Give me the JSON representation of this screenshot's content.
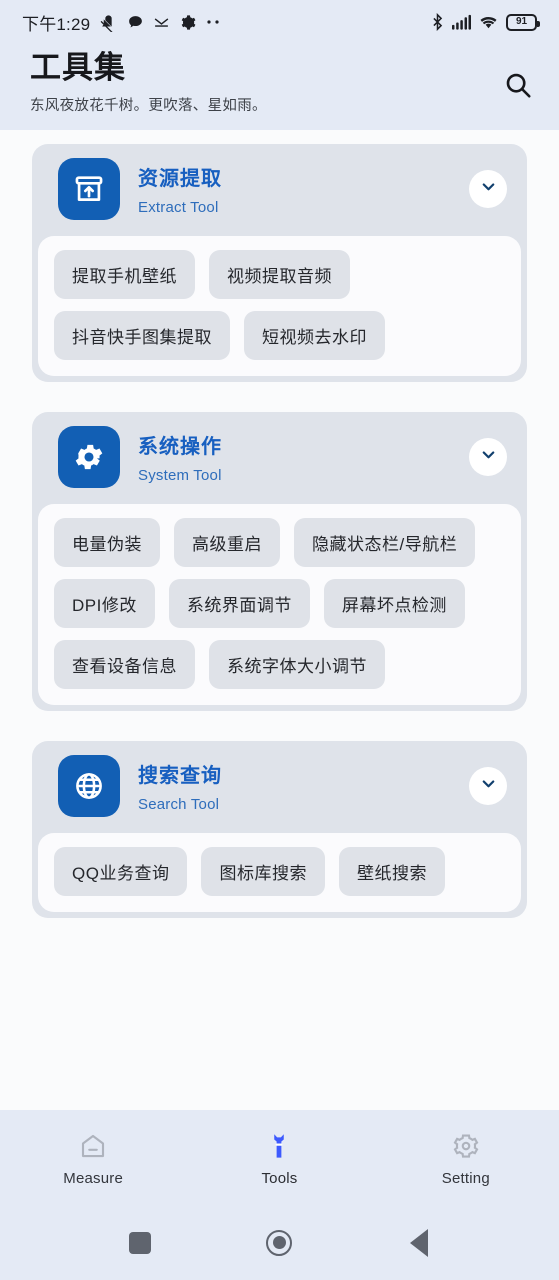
{
  "status_bar": {
    "time": "下午1:29",
    "left_icons": [
      "mute-icon",
      "chat-bubble-icon",
      "check-mail-icon",
      "gear-icon",
      "more-dots-icon"
    ],
    "right_icons": [
      "bluetooth-icon",
      "cellular-signal-icon",
      "wifi-icon"
    ],
    "battery_level": "91"
  },
  "header": {
    "title": "工具集",
    "subtitle": "东风夜放花千树。更吹落、星如雨。",
    "search_icon": "search-icon"
  },
  "groups": [
    {
      "icon": "archive-upload-icon",
      "title_cn": "资源提取",
      "title_en": "Extract Tool",
      "toggle_icon": "chevron-down-icon",
      "expanded": true,
      "chips": [
        "提取手机壁纸",
        "视频提取音频",
        "抖音快手图集提取",
        "短视频去水印"
      ]
    },
    {
      "icon": "gear-icon",
      "title_cn": "系统操作",
      "title_en": "System Tool",
      "toggle_icon": "chevron-down-icon",
      "expanded": true,
      "chips": [
        "电量伪装",
        "高级重启",
        "隐藏状态栏/导航栏",
        "DPI修改",
        "系统界面调节",
        "屏幕坏点检测",
        "查看设备信息",
        "系统字体大小调节"
      ]
    },
    {
      "icon": "globe-icon",
      "title_cn": "搜索查询",
      "title_en": "Search Tool",
      "toggle_icon": "chevron-down-icon",
      "expanded": true,
      "chips": [
        "QQ业务查询",
        "图标库搜索",
        "壁纸搜索"
      ]
    }
  ],
  "bottom_nav": {
    "items": [
      {
        "label": "Measure",
        "icon": "home-measure-icon",
        "active": false
      },
      {
        "label": "Tools",
        "icon": "wrench-icon",
        "active": true
      },
      {
        "label": "Setting",
        "icon": "gear-icon",
        "active": false
      }
    ]
  },
  "system_nav": {
    "recents_icon": "square-recents-icon",
    "home_icon": "circle-home-icon",
    "back_icon": "triangle-back-icon"
  },
  "colors": {
    "accent_blue": "#125fb4",
    "title_blue": "#175fc0",
    "nav_active": "#3d5afe",
    "header_bg": "#e4eaf5",
    "card_bg": "#dfe3ea",
    "chip_bg": "#dfe2e8",
    "page_bg": "#fafbfc"
  }
}
